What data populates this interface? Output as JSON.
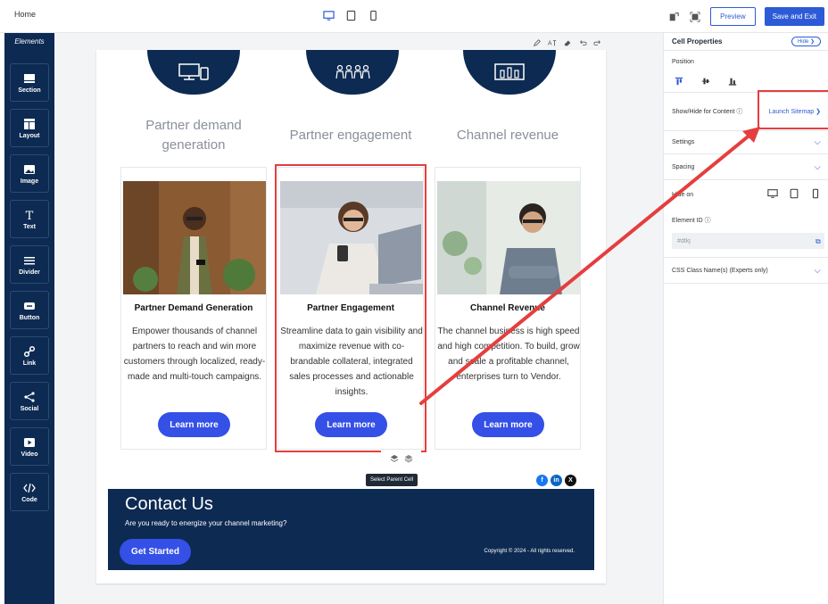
{
  "topbar": {
    "home": "Home",
    "preview": "Preview",
    "save_exit": "Save and Exit"
  },
  "sidebar": {
    "title": "Elements",
    "tools": [
      {
        "label": "Section",
        "icon": "section-icon"
      },
      {
        "label": "Layout",
        "icon": "layout-icon"
      },
      {
        "label": "Image",
        "icon": "image-icon"
      },
      {
        "label": "Text",
        "icon": "text-icon"
      },
      {
        "label": "Divider",
        "icon": "divider-icon"
      },
      {
        "label": "Button",
        "icon": "button-icon"
      },
      {
        "label": "Link",
        "icon": "link-icon"
      },
      {
        "label": "Social",
        "icon": "share-icon"
      },
      {
        "label": "Video",
        "icon": "video-icon"
      },
      {
        "label": "Code",
        "icon": "code-icon"
      }
    ]
  },
  "columns": [
    {
      "title": "Partner demand generation"
    },
    {
      "title": "Partner engagement"
    },
    {
      "title": "Channel revenue"
    }
  ],
  "cards": [
    {
      "title": "Partner Demand Generation",
      "desc": "Empower thousands of channel partners to reach and win more customers through localized, ready-made and multi-touch campaigns.",
      "button": "Learn more"
    },
    {
      "title": "Partner Engagement",
      "desc": "Streamline data to gain visibility and maximize revenue with co-brandable collateral, integrated sales processes and actionable insights.",
      "button": "Learn more"
    },
    {
      "title": "Channel Revenue",
      "desc": "The channel business is high speed and high competition. To build, grow and scale a profitable channel, enterprises turn to Vendor.",
      "button": "Learn more"
    }
  ],
  "tooltip": "Select Parent Cell",
  "footer": {
    "title": "Contact Us",
    "subtitle": "Are you ready to energize your channel marketing?",
    "button": "Get Started",
    "copyright": "Copyright © 2024 - All rights reserved."
  },
  "panel": {
    "title": "Cell Properties",
    "hide": "Hide",
    "position": "Position",
    "show_hide": "Show/Hide for Content",
    "launch_sitemap": "Launch Sitemap",
    "settings": "Settings",
    "spacing": "Spacing",
    "hide_on": "Hide on",
    "element_id": "Element ID",
    "element_id_value": "#dtkj",
    "css_class": "CSS Class Name(s) (Experts only)"
  },
  "colors": {
    "navy": "#0d2a52",
    "accent": "#3550e6",
    "highlight": "#e53e3e"
  }
}
